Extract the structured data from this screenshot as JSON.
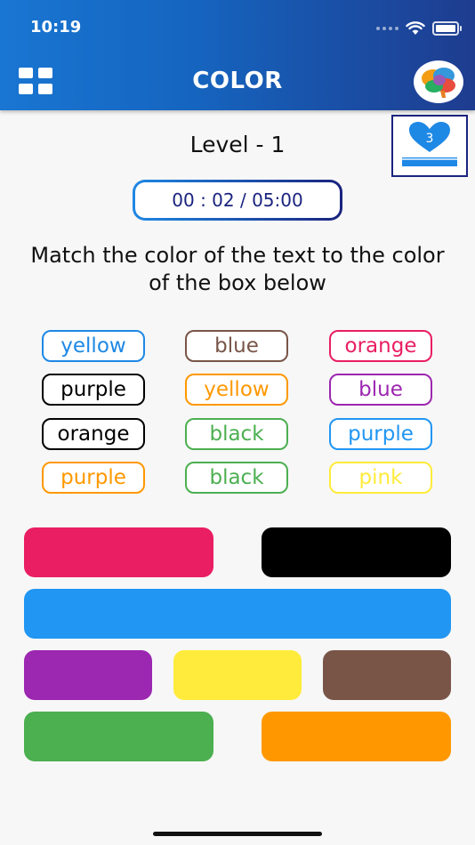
{
  "status_bar": {
    "time": "10:19"
  },
  "header": {
    "title": "COLOR"
  },
  "game": {
    "level": "Level - 1",
    "lives": "3",
    "timer": "00 : 02 / 05:00",
    "instruction": "Match the color of the text to the color of the box below"
  },
  "words": [
    {
      "label": "yellow",
      "color": "#1e88e5"
    },
    {
      "label": "blue",
      "color": "#795548"
    },
    {
      "label": "orange",
      "color": "#e91e63"
    },
    {
      "label": "purple",
      "color": "#000000"
    },
    {
      "label": "yellow",
      "color": "#ff9800"
    },
    {
      "label": "blue",
      "color": "#9c27b0"
    },
    {
      "label": "orange",
      "color": "#000000"
    },
    {
      "label": "black",
      "color": "#4caf50"
    },
    {
      "label": "purple",
      "color": "#2196f3"
    },
    {
      "label": "purple",
      "color": "#ff9800"
    },
    {
      "label": "black",
      "color": "#4caf50"
    },
    {
      "label": "pink",
      "color": "#ffeb3b"
    }
  ],
  "color_blocks": [
    {
      "name": "pink",
      "color": "#e91e63"
    },
    {
      "name": "black",
      "color": "#000000"
    },
    {
      "name": "blue",
      "color": "#2196f3"
    },
    {
      "name": "purple",
      "color": "#9c27b0"
    },
    {
      "name": "yellow",
      "color": "#ffeb3b"
    },
    {
      "name": "brown",
      "color": "#795548"
    },
    {
      "name": "green",
      "color": "#4caf50"
    },
    {
      "name": "orange",
      "color": "#ff9800"
    }
  ],
  "icons": {
    "menu": "grid-menu-icon",
    "avatar": "brain-icon",
    "lives": "heart-icon",
    "wifi": "wifi-icon",
    "battery": "battery-icon",
    "signal": "signal-icon"
  },
  "theme": {
    "header_start": "#1976d2",
    "header_end": "#1e3c8f",
    "accent": "#1a237e"
  }
}
